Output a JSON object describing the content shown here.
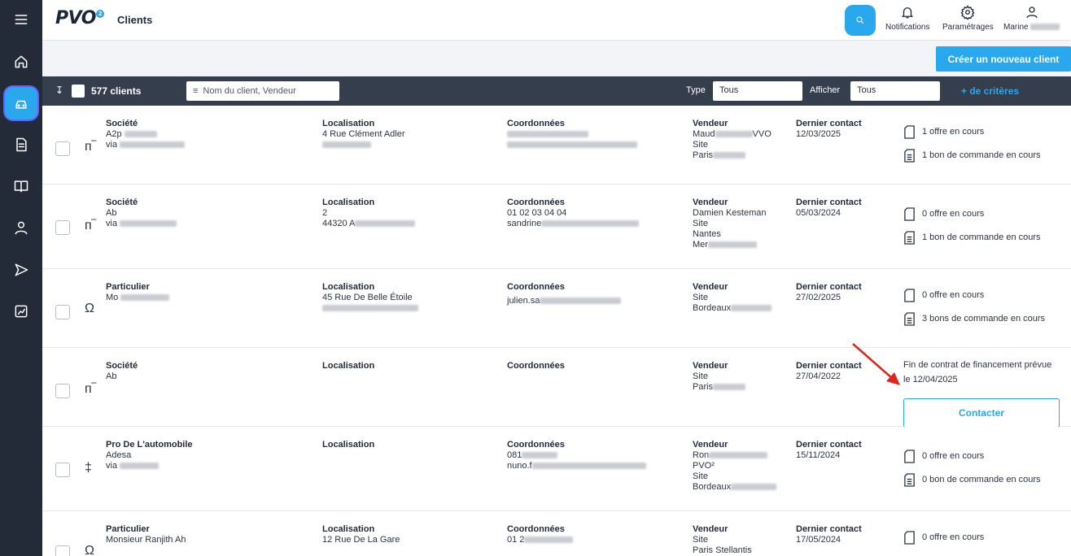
{
  "header": {
    "logo": "PVO",
    "logo_badge": "2",
    "title": "Clients",
    "notifications_label": "Notifications",
    "settings_label": "Paramétrages",
    "user_label": "Marine"
  },
  "actions": {
    "create_label": "Créer un nouveau client"
  },
  "filters": {
    "count_label": "577 clients",
    "search_placeholder": "Nom du client, Vendeur",
    "type_label": "Type",
    "type_value": "Tous",
    "show_label": "Afficher",
    "show_value": "Tous",
    "more_criteria": "+ de critères"
  },
  "columns": {
    "localisation": "Localisation",
    "coordonnees": "Coordonnées",
    "vendeur": "Vendeur",
    "dernier_contact": "Dernier contact",
    "site": "Site"
  },
  "rows": [
    {
      "type": "Société",
      "name": "A2p",
      "via": "via",
      "loc1": "4 Rue Clément Adler",
      "loc2": "",
      "coord1": "",
      "coord2": "",
      "vendeur": "Maud",
      "vendeur_suffix": "VVO",
      "site": "Paris",
      "date": "12/03/2025",
      "offer": "1 offre en cours",
      "order": "1 bon de commande en cours"
    },
    {
      "type": "Société",
      "name": "Ab",
      "via": "via",
      "loc1": "2",
      "loc2": "44320 A",
      "coord1": "01 02 03 04 04",
      "coord2": "sandrine",
      "vendeur": "Damien Kesteman",
      "vendeur_suffix": "",
      "site": "Nantes",
      "site2": "Mer",
      "date": "05/03/2024",
      "offer": "0 offre en cours",
      "order": "1 bon de commande en cours"
    },
    {
      "type": "Particulier",
      "name": "Mo",
      "via": "",
      "loc1": "45 Rue De Belle Étoile",
      "loc2": "",
      "coord1": "julien.sa",
      "coord2": "",
      "vendeur": "",
      "vendeur_suffix": "",
      "site": "Bordeaux",
      "date": "27/02/2025",
      "offer": "0 offre en cours",
      "order": "3 bons de commande en cours"
    },
    {
      "type": "Société",
      "name": "Ab",
      "via": "",
      "loc1": "",
      "loc2": "",
      "coord1": "",
      "coord2": "",
      "vendeur": "",
      "vendeur_suffix": "",
      "site": "Paris",
      "date": "27/04/2022",
      "notice": "Fin de contrat de financement prévue le 12/04/2025",
      "contact_label": "Contacter"
    },
    {
      "type": "Pro De L'automobile",
      "name": "Adesa",
      "via": "via",
      "loc1": "",
      "loc2": "",
      "coord1": "081",
      "coord2": "nuno.f",
      "vendeur": "Ron",
      "vendeur_suffix": "",
      "vendeur2": "PVO²",
      "site": "Bordeaux",
      "date": "15/11/2024",
      "offer": "0 offre en cours",
      "order": "0 bon de commande en cours"
    },
    {
      "type": "Particulier",
      "name": "Monsieur Ranjith Ah",
      "via": "",
      "loc1": "12 Rue De La Gare",
      "loc2": "",
      "coord1": "01 2",
      "coord2": "",
      "vendeur": "",
      "vendeur_suffix": "",
      "site": "Paris Stellantis",
      "date": "17/05/2024",
      "offer": "0 offre en cours",
      "order": ""
    }
  ],
  "colors": {
    "accent": "#2aa8ee",
    "sidebar": "#232b38",
    "filterbar": "#353e4c"
  }
}
